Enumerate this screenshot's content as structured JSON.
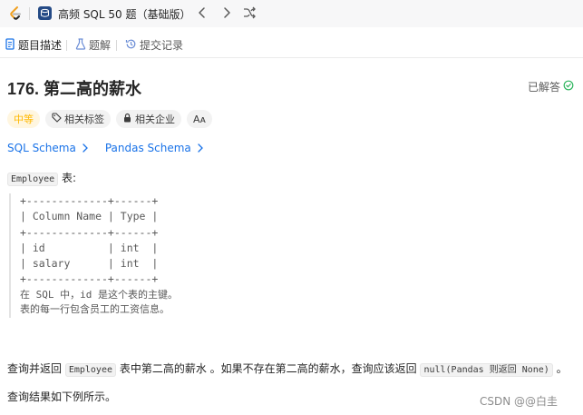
{
  "topbar": {
    "plan_title": "高频 SQL 50 题（基础版）"
  },
  "tabs": [
    {
      "label": "题目描述"
    },
    {
      "label": "题解"
    },
    {
      "label": "提交记录"
    }
  ],
  "problem": {
    "title": "176. 第二高的薪水",
    "status": "已解答",
    "tags": {
      "difficulty": "中等",
      "related_tags": "相关标签",
      "related_company": "相关企业",
      "font_toggle": "Aᴀ"
    },
    "links": [
      "SQL Schema",
      "Pandas Schema"
    ],
    "table_intro_code": "Employee",
    "table_intro_suffix": " 表:",
    "schema_lines": [
      "+-------------+------+",
      "| Column Name | Type |",
      "+-------------+------+",
      "| id          | int  |",
      "| salary      | int  |",
      "+-------------+------+"
    ],
    "schema_note_1": "在 SQL 中，id 是这个表的主键。",
    "schema_note_2": "表的每一行包含员工的工资信息。",
    "query_part1": "查询并返回 ",
    "query_code1": "Employee",
    "query_part2": " 表中第二高的薪水 。如果不存在第二高的薪水，查询应该返回 ",
    "query_code2": "null(Pandas 则返回 None)",
    "query_part3": " 。",
    "result_format": "查询结果如下例所示。"
  },
  "watermark": "CSDN @@白圭",
  "colors": {
    "link": "#1a73e8",
    "difficulty_medium": "#ffb800",
    "solved_check": "#2db55d"
  }
}
